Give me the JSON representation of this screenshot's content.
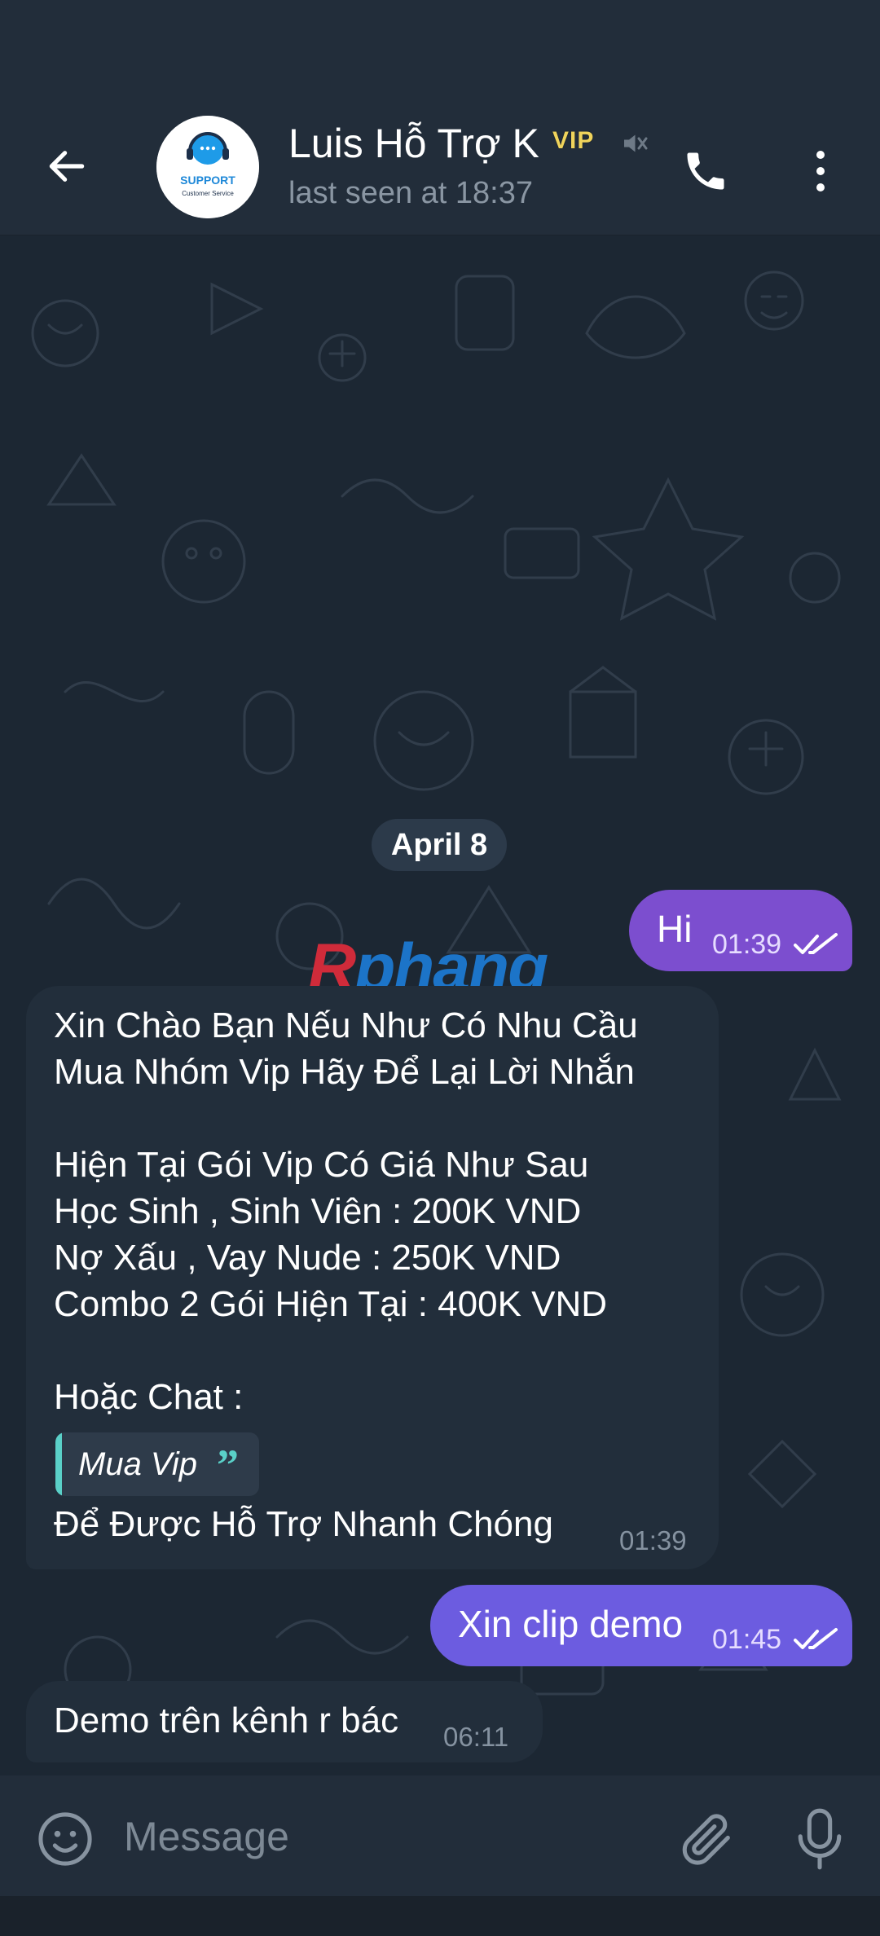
{
  "header": {
    "title": "Luis Hỗ Trợ K",
    "badge": "VIP",
    "subtitle": "last seen at 18:37",
    "avatar": {
      "line1": "SUPPORT",
      "line2": "Customer Service"
    }
  },
  "chat": {
    "date_separator": "April 8",
    "watermark": {
      "first": "R",
      "rest": "phang"
    },
    "messages": [
      {
        "direction": "out",
        "text": "Hi",
        "time": "01:39",
        "status": "read"
      },
      {
        "direction": "in",
        "lines": [
          "Xin Chào Bạn Nếu Như Có Nhu Cầu",
          "Mua Nhóm Vip Hãy Để Lại Lời Nhắn",
          "",
          "Hiện Tại Gói Vip Có Giá Như Sau",
          "Học Sinh , Sinh Viên : 200K VND",
          "Nợ Xấu , Vay Nude : 250K VND",
          "Combo 2 Gói Hiện Tại : 400K VND",
          "",
          "Hoặc Chat :"
        ],
        "quote": "Mua Vip",
        "footer": "Để Được Hỗ Trợ Nhanh Chóng",
        "time": "01:39"
      },
      {
        "direction": "out",
        "text": "Xin clip demo",
        "time": "01:45",
        "status": "read"
      },
      {
        "direction": "in",
        "text": "Demo trên kênh r bác",
        "time": "06:11"
      }
    ]
  },
  "composer": {
    "placeholder": "Message"
  },
  "icons": {
    "back": "arrow-left",
    "mute": "speaker-muted",
    "call": "phone",
    "menu": "dots-vertical",
    "emoji": "smiley",
    "attach": "paperclip",
    "mic": "microphone",
    "read_status": "double-check"
  },
  "colors": {
    "header_bg": "#222d3a",
    "chat_bg": "#1c2733",
    "outgoing_bubble_1": "#7c4ecf",
    "outgoing_bubble_2": "#6c5ce0",
    "incoming_bubble": "#222e3b",
    "quote_accent": "#5ad0c8",
    "badge": "#f0d45c"
  }
}
